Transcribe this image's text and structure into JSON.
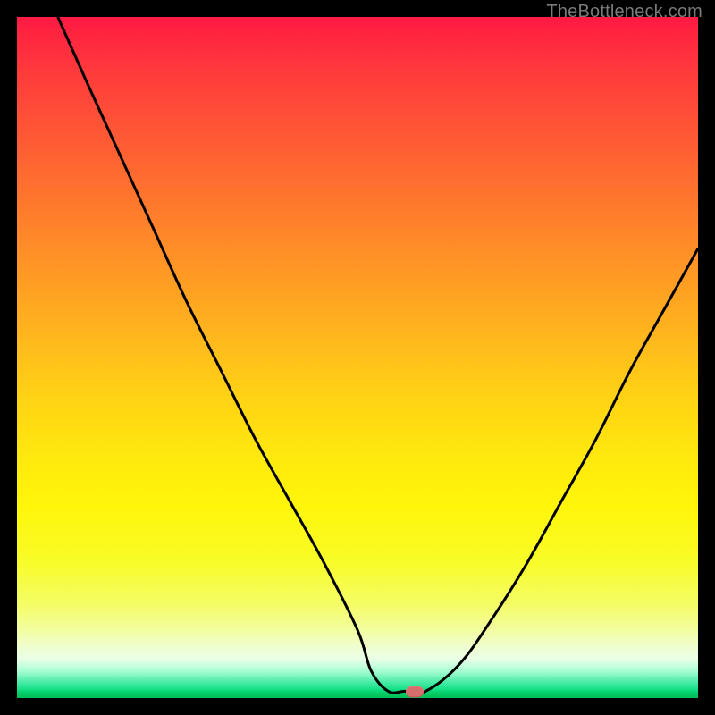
{
  "watermark": "TheBottleneck.com",
  "chart_data": {
    "type": "line",
    "title": "",
    "xlabel": "",
    "ylabel": "",
    "xlim": [
      0,
      100
    ],
    "ylim": [
      0,
      100
    ],
    "grid": false,
    "legend": false,
    "series": [
      {
        "name": "curve",
        "x": [
          6,
          10,
          15,
          20,
          25,
          30,
          35,
          40,
          45,
          50,
          52,
          54.5,
          57,
          60,
          65,
          70,
          75,
          80,
          85,
          90,
          95,
          100
        ],
        "values": [
          100,
          91,
          80,
          69,
          58,
          48,
          38,
          29,
          20,
          10,
          4,
          1,
          1,
          1,
          5,
          12,
          20,
          29,
          38,
          48,
          57,
          66
        ]
      }
    ],
    "marker": {
      "x": 58.4,
      "y": 0.9
    },
    "background_gradient": {
      "direction": "top-to-bottom",
      "stops": [
        {
          "pct": 0,
          "color": "#ff1a42"
        },
        {
          "pct": 50,
          "color": "#ffd314"
        },
        {
          "pct": 80,
          "color": "#f8fc28"
        },
        {
          "pct": 95,
          "color": "#c8ffdf"
        },
        {
          "pct": 100,
          "color": "#00bf59"
        }
      ]
    }
  }
}
